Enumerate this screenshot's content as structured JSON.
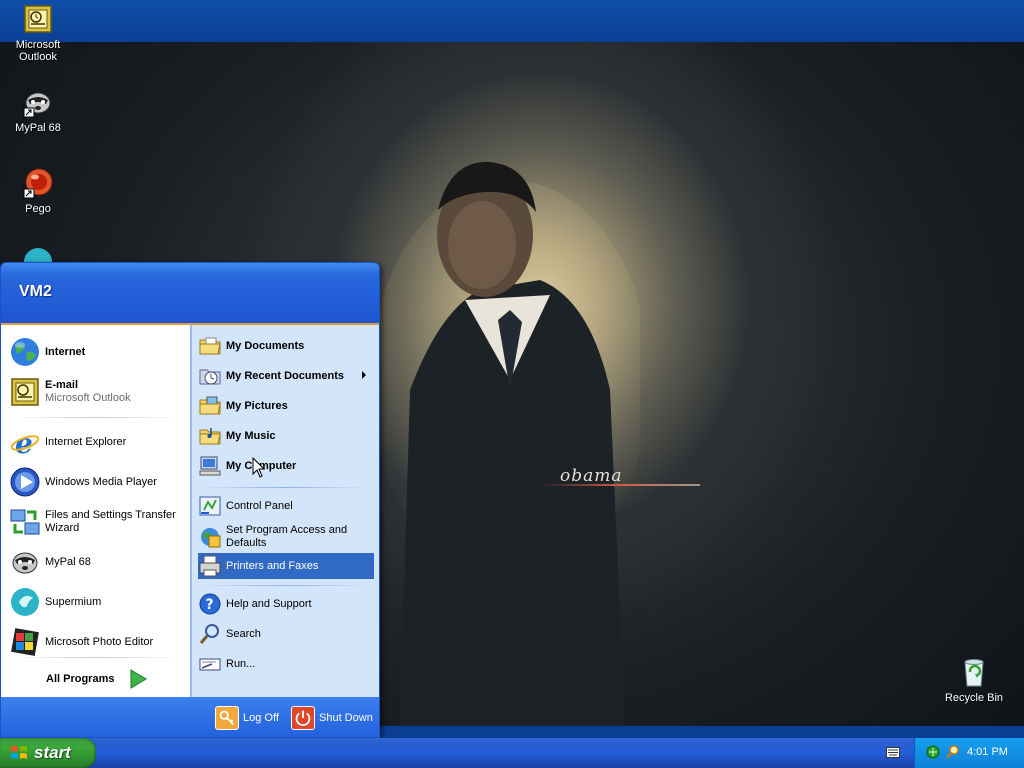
{
  "desktop": {
    "icons": [
      {
        "label": "Microsoft Outlook"
      },
      {
        "label": "MyPal 68"
      },
      {
        "label": "Pego"
      },
      {
        "label": "Recycle Bin"
      }
    ],
    "wallpaper_caption": "obama"
  },
  "start_menu": {
    "user_name": "VM2",
    "pinned": [
      {
        "title": "Internet"
      },
      {
        "title": "E-mail",
        "subtitle": "Microsoft Outlook"
      }
    ],
    "recent": [
      {
        "title": "Internet Explorer"
      },
      {
        "title": "Windows Media Player"
      },
      {
        "title": "Files and Settings Transfer Wizard"
      },
      {
        "title": "MyPal 68"
      },
      {
        "title": "Supermium"
      },
      {
        "title": "Microsoft Photo Editor"
      }
    ],
    "all_programs_label": "All Programs",
    "places": [
      {
        "title": "My Documents"
      },
      {
        "title": "My Recent Documents"
      },
      {
        "title": "My Pictures"
      },
      {
        "title": "My Music"
      },
      {
        "title": "My Computer"
      }
    ],
    "settings": [
      {
        "title": "Control Panel"
      },
      {
        "title": "Set Program Access and Defaults"
      },
      {
        "title": "Printers and Faxes"
      }
    ],
    "tools": [
      {
        "title": "Help and Support"
      },
      {
        "title": "Search"
      },
      {
        "title": "Run..."
      }
    ],
    "log_off_label": "Log Off",
    "shut_down_label": "Shut Down",
    "highlighted_item": "Printers and Faxes"
  },
  "taskbar": {
    "start_label": "start",
    "clock": "4:01 PM"
  },
  "colors": {
    "menu_blue": "#2968de",
    "right_pane": "#d3e5fa",
    "highlight": "#316ac5",
    "start_green": "#3aa83a",
    "tray_blue": "#16a0ef"
  }
}
